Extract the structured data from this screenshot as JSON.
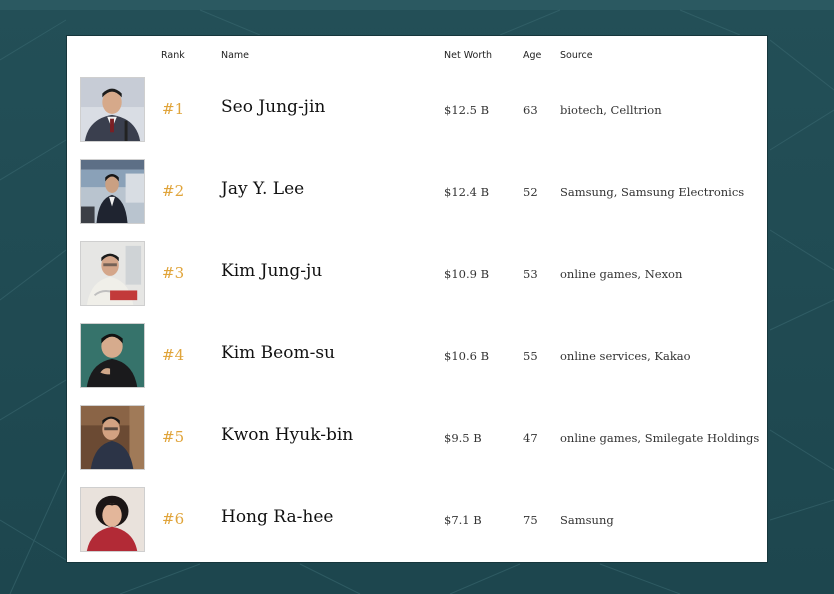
{
  "table": {
    "headers": {
      "rank": "Rank",
      "name": "Name",
      "net_worth": "Net Worth",
      "age": "Age",
      "source": "Source"
    },
    "rows": [
      {
        "rank": "#1",
        "name": "Seo Jung-jin",
        "net_worth": "$12.5 B",
        "age": "63",
        "source": "biotech, Celltrion"
      },
      {
        "rank": "#2",
        "name": "Jay Y. Lee",
        "net_worth": "$12.4 B",
        "age": "52",
        "source": "Samsung, Samsung Electronics"
      },
      {
        "rank": "#3",
        "name": "Kim Jung-ju",
        "net_worth": "$10.9 B",
        "age": "53",
        "source": "online games, Nexon"
      },
      {
        "rank": "#4",
        "name": "Kim Beom-su",
        "net_worth": "$10.6 B",
        "age": "55",
        "source": "online services, Kakao"
      },
      {
        "rank": "#5",
        "name": "Kwon Hyuk-bin",
        "net_worth": "$9.5 B",
        "age": "47",
        "source": "online games, Smilegate Holdings"
      },
      {
        "rank": "#6",
        "name": "Hong Ra-hee",
        "net_worth": "$7.1 B",
        "age": "75",
        "source": "Samsung"
      }
    ]
  },
  "colors": {
    "rank_accent": "#e0a43a",
    "background": "#1f4a52",
    "card": "#ffffff"
  }
}
